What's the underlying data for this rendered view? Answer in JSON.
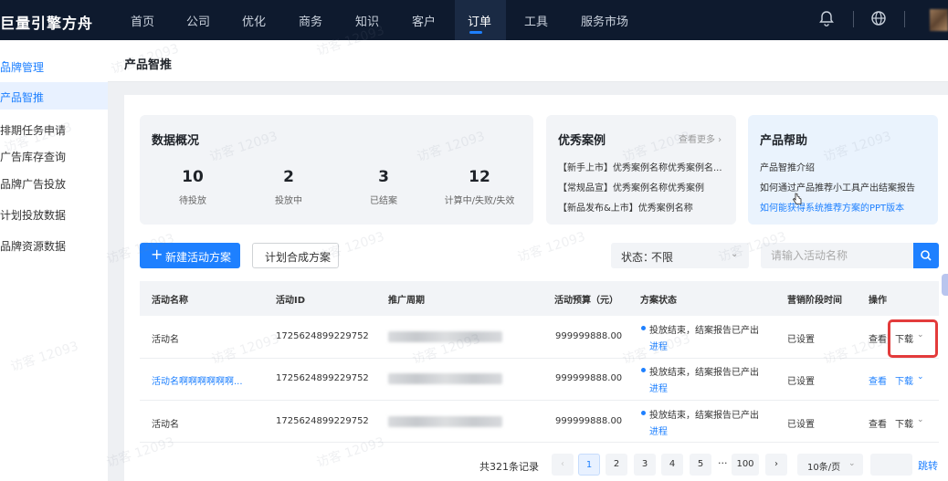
{
  "topnav": {
    "logo": "巨量引擎方舟",
    "items": [
      {
        "label": "首页"
      },
      {
        "label": "公司"
      },
      {
        "label": "优化"
      },
      {
        "label": "商务"
      },
      {
        "label": "知识"
      },
      {
        "label": "客户"
      },
      {
        "label": "订单",
        "active": true
      },
      {
        "label": "工具"
      },
      {
        "label": "服务市场"
      }
    ],
    "icons": [
      "bell-icon",
      "globe-icon",
      "avatar"
    ]
  },
  "sidebar": {
    "group": "品牌管理",
    "items": [
      {
        "label": "产品智推",
        "active": true
      },
      {
        "label": "排期任务申请"
      },
      {
        "label": "广告库存查询"
      },
      {
        "label": "品牌广告投放"
      },
      {
        "label": "计划投放数据"
      },
      {
        "label": "品牌资源数据"
      }
    ]
  },
  "page": {
    "title": "产品智推"
  },
  "overview": {
    "title": "数据概况",
    "stats": [
      {
        "value": "10",
        "label": "待投放"
      },
      {
        "value": "2",
        "label": "投放中"
      },
      {
        "value": "3",
        "label": "已结案"
      },
      {
        "value": "12",
        "label": "计算中/失败/失效"
      }
    ]
  },
  "cases": {
    "title": "优秀案例",
    "more": "查看更多 ›",
    "items": [
      "【新手上市】优秀案例名称优秀案例名...",
      "【常规品宣】优秀案例名称优秀案例",
      "【新品发布&上市】优秀案例名称"
    ]
  },
  "help": {
    "title": "产品帮助",
    "items": [
      {
        "text": "产品智推介绍",
        "link": false
      },
      {
        "text": "如何通过产品推荐小工具产出结案报告",
        "link": false
      },
      {
        "text": "如何能获得系统推荐方案的PPT版本",
        "link": true
      }
    ]
  },
  "toolbar": {
    "new_button": "新建活动方案",
    "plan_button": "计划合成方案",
    "status_label": "状态：",
    "status_value": "不限",
    "search_placeholder": "请输入活动名称"
  },
  "table": {
    "columns": [
      "活动名称",
      "活动ID",
      "推广周期",
      "活动预算（元）",
      "方案状态",
      "营销阶段时间",
      "操作"
    ],
    "rows": [
      {
        "name": "活动名",
        "name_link": false,
        "id": "1725624899229752",
        "budget": "999999888.00",
        "status": "投放结束，结案报告已产出",
        "progress": "进程",
        "stage": "已设置",
        "op_view": "查看",
        "op_download": "下载",
        "op_link": false
      },
      {
        "name": "活动名啊啊啊啊啊啊...",
        "name_link": true,
        "id": "1725624899229752",
        "budget": "999999888.00",
        "status": "投放结束，结案报告已产出",
        "progress": "进程",
        "stage": "已设置",
        "op_view": "查看",
        "op_download": "下载",
        "op_link": true
      },
      {
        "name": "活动名",
        "name_link": false,
        "id": "1725624899229752",
        "budget": "999999888.00",
        "status": "投放结束，结案报告已产出",
        "progress": "进程",
        "stage": "已设置",
        "op_view": "查看",
        "op_download": "下载",
        "op_link": false
      }
    ]
  },
  "pagination": {
    "total": "共321条记录",
    "pages": [
      "1",
      "2",
      "3",
      "4",
      "5",
      "100"
    ],
    "current": "1",
    "ellipsis": "···",
    "page_size": "10条/页",
    "jump": "跳转"
  },
  "watermark": "访客 12093",
  "colors": {
    "primary": "#1e80ff",
    "nav_bg": "#0e1a2e",
    "highlight": "#e33b3b"
  }
}
